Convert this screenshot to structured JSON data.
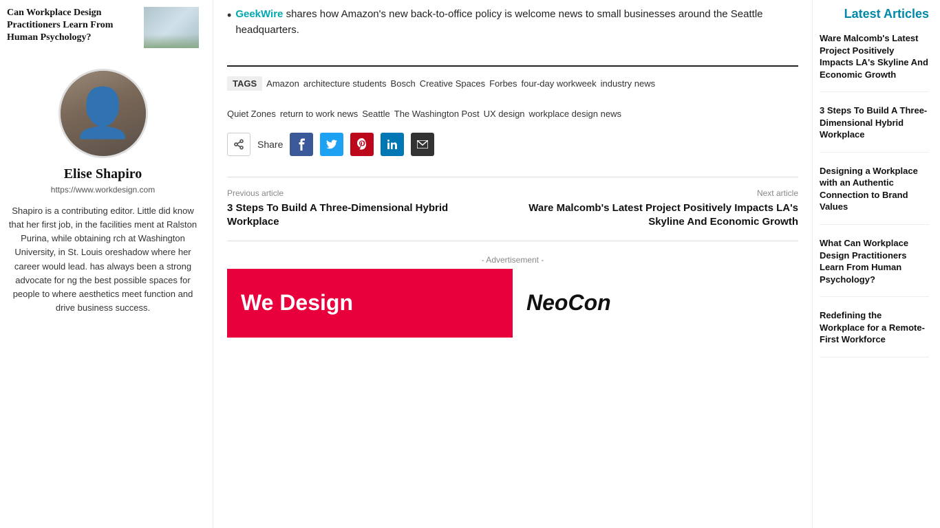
{
  "teaser": {
    "title": "Can Workplace Design Practitioners Learn From Human Psychology?",
    "img_alt": "Office interior"
  },
  "geekwire": {
    "source": "GeekWire",
    "text": "shares how Amazon's new back-to-office policy is welcome news to small businesses around the Seattle headquarters."
  },
  "tags_label": "TAGS",
  "tags_row1": [
    "Amazon",
    "architecture students",
    "Bosch",
    "Creative Spaces",
    "Forbes",
    "four-day workweek",
    "industry news"
  ],
  "tags_row2": [
    "Quiet Zones",
    "return to work news",
    "Seattle",
    "The Washington Post",
    "UX design",
    "workplace design news"
  ],
  "share": {
    "label": "Share",
    "buttons": [
      {
        "name": "facebook",
        "color": "#3b5998",
        "icon": "f"
      },
      {
        "name": "twitter",
        "color": "#1da1f2",
        "icon": "t"
      },
      {
        "name": "pinterest",
        "color": "#bd081c",
        "icon": "p"
      },
      {
        "name": "linkedin",
        "color": "#0077b5",
        "icon": "in"
      },
      {
        "name": "email",
        "color": "#333",
        "icon": "✉"
      }
    ]
  },
  "article_nav": {
    "previous_label": "Previous article",
    "previous_title": "3 Steps To Build A Three-Dimensional Hybrid Workplace",
    "next_label": "Next article",
    "next_title": "Ware Malcomb's Latest Project Positively Impacts LA's Skyline And Economic Growth"
  },
  "advertisement": {
    "label": "- Advertisement -",
    "text_left": "We Design",
    "text_right": "NeoCon"
  },
  "author": {
    "name": "Elise Shapiro",
    "url": "https://www.workdesign.com",
    "bio": "Shapiro is a contributing editor. Little did know that her first job, in the facilities ment at Ralston Purina, while obtaining rch at Washington University, in St. Louis oreshadow where her career would lead. has always been a strong advocate for ng the best possible spaces for people to where aesthetics meet function and drive business success."
  },
  "latest_articles": {
    "section_title": "Latest Articles",
    "items": [
      {
        "title": "Ware Malcomb's Latest Project Positively Impacts LA's Skyline And Economic Growth"
      },
      {
        "title": "3 Steps To Build A Three-Dimensional Hybrid Workplace"
      },
      {
        "title": "Designing a Workplace with an Authentic Connection to Brand Values"
      },
      {
        "title": "What Can Workplace Design Practitioners Learn From Human Psychology?"
      },
      {
        "title": "Redefining the Workplace for a Remote-First Workforce"
      }
    ]
  }
}
